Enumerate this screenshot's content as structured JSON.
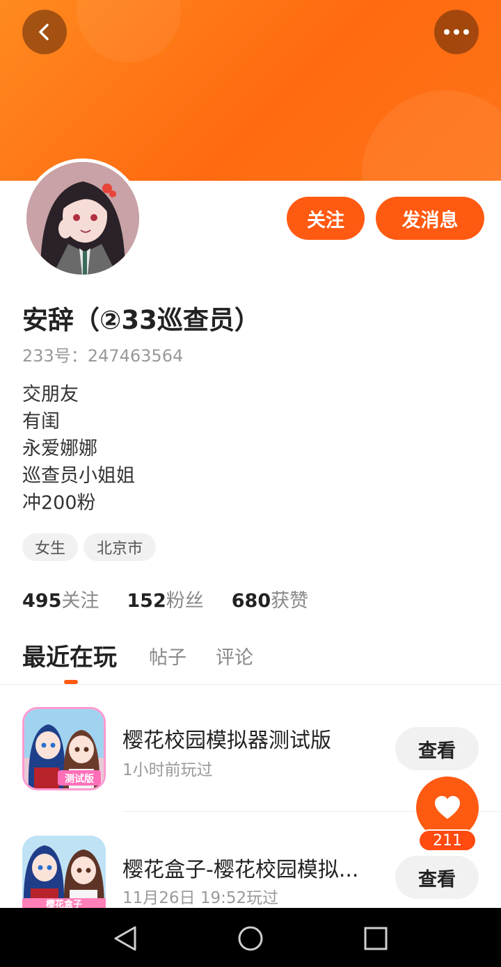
{
  "header": {
    "back_icon": "chevron-left-icon",
    "more_icon": "more-dots-icon"
  },
  "profile": {
    "name": "安辞（②33巡查员）",
    "uid": "233号：247463564",
    "bio": [
      "交朋友",
      "有闺",
      "永爱娜娜",
      "巡查员小姐姐",
      "冲200粉"
    ],
    "tags": {
      "gender": "女生",
      "city": "北京市"
    }
  },
  "actions": {
    "follow_label": "关注",
    "message_label": "发消息"
  },
  "stats": {
    "following": {
      "value": "495",
      "label": "关注"
    },
    "fans": {
      "value": "152",
      "label": "粉丝"
    },
    "likes": {
      "value": "680",
      "label": "获赞"
    }
  },
  "tabs": {
    "recent": "最近在玩",
    "posts": "帖子",
    "comments": "评论",
    "active": "recent"
  },
  "games": [
    {
      "title": "樱花校园模拟器测试版",
      "time": "1小时前玩过",
      "button": "查看",
      "icon_badge": "测试版"
    },
    {
      "title": "樱花盒子-樱花校园模拟...",
      "time": "11月26日 19:52玩过",
      "button": "查看",
      "icon_badge": "樱花盒子"
    }
  ],
  "like_float": {
    "count": "211",
    "icon": "heart-icon"
  },
  "colors": {
    "accent": "#ff5a12",
    "banner": "#ff7418"
  },
  "nav": {
    "back_icon": "triangle-back-icon",
    "home_icon": "circle-home-icon",
    "recents_icon": "square-recents-icon"
  }
}
